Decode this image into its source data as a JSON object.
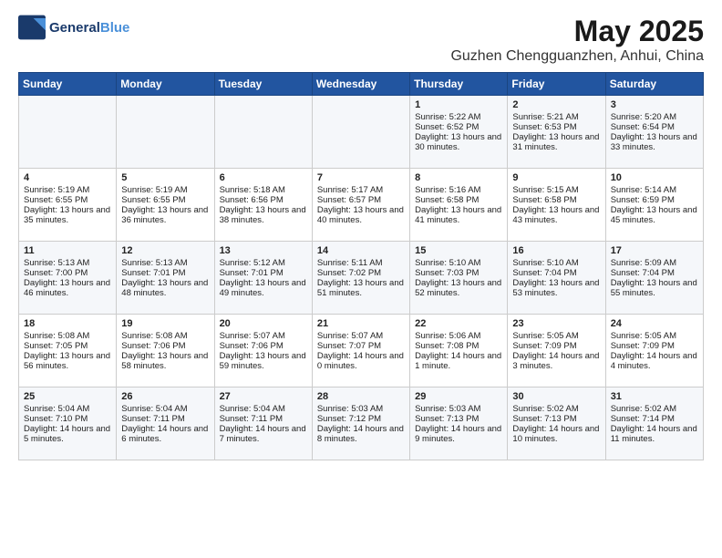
{
  "header": {
    "logo_line1": "General",
    "logo_line2": "Blue",
    "month": "May 2025",
    "location": "Guzhen Chengguanzhen, Anhui, China"
  },
  "weekdays": [
    "Sunday",
    "Monday",
    "Tuesday",
    "Wednesday",
    "Thursday",
    "Friday",
    "Saturday"
  ],
  "weeks": [
    [
      {
        "day": "",
        "info": ""
      },
      {
        "day": "",
        "info": ""
      },
      {
        "day": "",
        "info": ""
      },
      {
        "day": "",
        "info": ""
      },
      {
        "day": "1",
        "info": "Sunrise: 5:22 AM\nSunset: 6:52 PM\nDaylight: 13 hours and 30 minutes."
      },
      {
        "day": "2",
        "info": "Sunrise: 5:21 AM\nSunset: 6:53 PM\nDaylight: 13 hours and 31 minutes."
      },
      {
        "day": "3",
        "info": "Sunrise: 5:20 AM\nSunset: 6:54 PM\nDaylight: 13 hours and 33 minutes."
      }
    ],
    [
      {
        "day": "4",
        "info": "Sunrise: 5:19 AM\nSunset: 6:55 PM\nDaylight: 13 hours and 35 minutes."
      },
      {
        "day": "5",
        "info": "Sunrise: 5:19 AM\nSunset: 6:55 PM\nDaylight: 13 hours and 36 minutes."
      },
      {
        "day": "6",
        "info": "Sunrise: 5:18 AM\nSunset: 6:56 PM\nDaylight: 13 hours and 38 minutes."
      },
      {
        "day": "7",
        "info": "Sunrise: 5:17 AM\nSunset: 6:57 PM\nDaylight: 13 hours and 40 minutes."
      },
      {
        "day": "8",
        "info": "Sunrise: 5:16 AM\nSunset: 6:58 PM\nDaylight: 13 hours and 41 minutes."
      },
      {
        "day": "9",
        "info": "Sunrise: 5:15 AM\nSunset: 6:58 PM\nDaylight: 13 hours and 43 minutes."
      },
      {
        "day": "10",
        "info": "Sunrise: 5:14 AM\nSunset: 6:59 PM\nDaylight: 13 hours and 45 minutes."
      }
    ],
    [
      {
        "day": "11",
        "info": "Sunrise: 5:13 AM\nSunset: 7:00 PM\nDaylight: 13 hours and 46 minutes."
      },
      {
        "day": "12",
        "info": "Sunrise: 5:13 AM\nSunset: 7:01 PM\nDaylight: 13 hours and 48 minutes."
      },
      {
        "day": "13",
        "info": "Sunrise: 5:12 AM\nSunset: 7:01 PM\nDaylight: 13 hours and 49 minutes."
      },
      {
        "day": "14",
        "info": "Sunrise: 5:11 AM\nSunset: 7:02 PM\nDaylight: 13 hours and 51 minutes."
      },
      {
        "day": "15",
        "info": "Sunrise: 5:10 AM\nSunset: 7:03 PM\nDaylight: 13 hours and 52 minutes."
      },
      {
        "day": "16",
        "info": "Sunrise: 5:10 AM\nSunset: 7:04 PM\nDaylight: 13 hours and 53 minutes."
      },
      {
        "day": "17",
        "info": "Sunrise: 5:09 AM\nSunset: 7:04 PM\nDaylight: 13 hours and 55 minutes."
      }
    ],
    [
      {
        "day": "18",
        "info": "Sunrise: 5:08 AM\nSunset: 7:05 PM\nDaylight: 13 hours and 56 minutes."
      },
      {
        "day": "19",
        "info": "Sunrise: 5:08 AM\nSunset: 7:06 PM\nDaylight: 13 hours and 58 minutes."
      },
      {
        "day": "20",
        "info": "Sunrise: 5:07 AM\nSunset: 7:06 PM\nDaylight: 13 hours and 59 minutes."
      },
      {
        "day": "21",
        "info": "Sunrise: 5:07 AM\nSunset: 7:07 PM\nDaylight: 14 hours and 0 minutes."
      },
      {
        "day": "22",
        "info": "Sunrise: 5:06 AM\nSunset: 7:08 PM\nDaylight: 14 hours and 1 minute."
      },
      {
        "day": "23",
        "info": "Sunrise: 5:05 AM\nSunset: 7:09 PM\nDaylight: 14 hours and 3 minutes."
      },
      {
        "day": "24",
        "info": "Sunrise: 5:05 AM\nSunset: 7:09 PM\nDaylight: 14 hours and 4 minutes."
      }
    ],
    [
      {
        "day": "25",
        "info": "Sunrise: 5:04 AM\nSunset: 7:10 PM\nDaylight: 14 hours and 5 minutes."
      },
      {
        "day": "26",
        "info": "Sunrise: 5:04 AM\nSunset: 7:11 PM\nDaylight: 14 hours and 6 minutes."
      },
      {
        "day": "27",
        "info": "Sunrise: 5:04 AM\nSunset: 7:11 PM\nDaylight: 14 hours and 7 minutes."
      },
      {
        "day": "28",
        "info": "Sunrise: 5:03 AM\nSunset: 7:12 PM\nDaylight: 14 hours and 8 minutes."
      },
      {
        "day": "29",
        "info": "Sunrise: 5:03 AM\nSunset: 7:13 PM\nDaylight: 14 hours and 9 minutes."
      },
      {
        "day": "30",
        "info": "Sunrise: 5:02 AM\nSunset: 7:13 PM\nDaylight: 14 hours and 10 minutes."
      },
      {
        "day": "31",
        "info": "Sunrise: 5:02 AM\nSunset: 7:14 PM\nDaylight: 14 hours and 11 minutes."
      }
    ]
  ]
}
